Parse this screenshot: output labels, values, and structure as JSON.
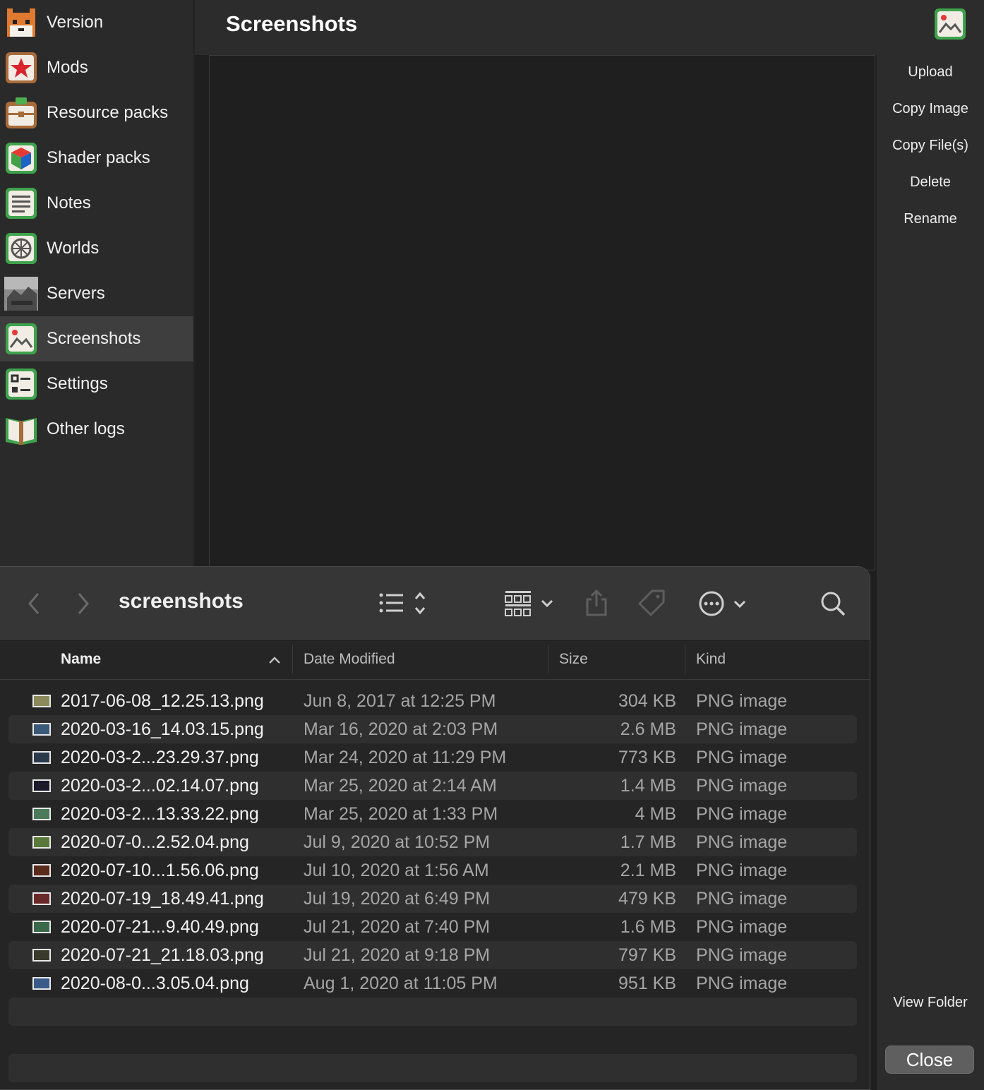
{
  "sidebar": {
    "items": [
      {
        "label": "Version",
        "icon": "fox-icon"
      },
      {
        "label": "Mods",
        "icon": "star-icon"
      },
      {
        "label": "Resource packs",
        "icon": "briefcase-icon"
      },
      {
        "label": "Shader packs",
        "icon": "cube-icon"
      },
      {
        "label": "Notes",
        "icon": "notes-icon"
      },
      {
        "label": "Worlds",
        "icon": "globe-icon"
      },
      {
        "label": "Servers",
        "icon": "server-thumbnail-icon"
      },
      {
        "label": "Screenshots",
        "icon": "image-icon",
        "active": true
      },
      {
        "label": "Settings",
        "icon": "settings-icon"
      },
      {
        "label": "Other logs",
        "icon": "book-icon"
      }
    ]
  },
  "header": {
    "title": "Screenshots",
    "icon": "image-icon"
  },
  "actions": {
    "upload": "Upload",
    "copy_image": "Copy Image",
    "copy_files": "Copy File(s)",
    "delete": "Delete",
    "rename": "Rename",
    "view_folder": "View Folder",
    "close": "Close"
  },
  "finder": {
    "folder": "screenshots",
    "columns": {
      "name": "Name",
      "date": "Date Modified",
      "size": "Size",
      "kind": "Kind"
    },
    "files": [
      {
        "name": "2017-06-08_12.25.13.png",
        "date": "Jun 8, 2017 at 12:25 PM",
        "size": "304 KB",
        "kind": "PNG image",
        "thumb": "#8a8a5a"
      },
      {
        "name": "2020-03-16_14.03.15.png",
        "date": "Mar 16, 2020 at 2:03 PM",
        "size": "2.6 MB",
        "kind": "PNG image",
        "thumb": "#3a5a7a"
      },
      {
        "name": "2020-03-2...23.29.37.png",
        "date": "Mar 24, 2020 at 11:29 PM",
        "size": "773 KB",
        "kind": "PNG image",
        "thumb": "#2a3a4a"
      },
      {
        "name": "2020-03-2...02.14.07.png",
        "date": "Mar 25, 2020 at 2:14 AM",
        "size": "1.4 MB",
        "kind": "PNG image",
        "thumb": "#1a1a2a"
      },
      {
        "name": "2020-03-2...13.33.22.png",
        "date": "Mar 25, 2020 at 1:33 PM",
        "size": "4 MB",
        "kind": "PNG image",
        "thumb": "#4a7a5a"
      },
      {
        "name": "2020-07-0...2.52.04.png",
        "date": "Jul 9, 2020 at 10:52 PM",
        "size": "1.7 MB",
        "kind": "PNG image",
        "thumb": "#5a7a3a"
      },
      {
        "name": "2020-07-10...1.56.06.png",
        "date": "Jul 10, 2020 at 1:56 AM",
        "size": "2.1 MB",
        "kind": "PNG image",
        "thumb": "#5a2a1a"
      },
      {
        "name": "2020-07-19_18.49.41.png",
        "date": "Jul 19, 2020 at 6:49 PM",
        "size": "479 KB",
        "kind": "PNG image",
        "thumb": "#6a2a2a"
      },
      {
        "name": "2020-07-21...9.40.49.png",
        "date": "Jul 21, 2020 at 7:40 PM",
        "size": "1.6 MB",
        "kind": "PNG image",
        "thumb": "#3a6a4a"
      },
      {
        "name": "2020-07-21_21.18.03.png",
        "date": "Jul 21, 2020 at 9:18 PM",
        "size": "797 KB",
        "kind": "PNG image",
        "thumb": "#3a3a2a"
      },
      {
        "name": "2020-08-0...3.05.04.png",
        "date": "Aug 1, 2020 at 11:05 PM",
        "size": "951 KB",
        "kind": "PNG image",
        "thumb": "#3a5a8a"
      }
    ]
  }
}
